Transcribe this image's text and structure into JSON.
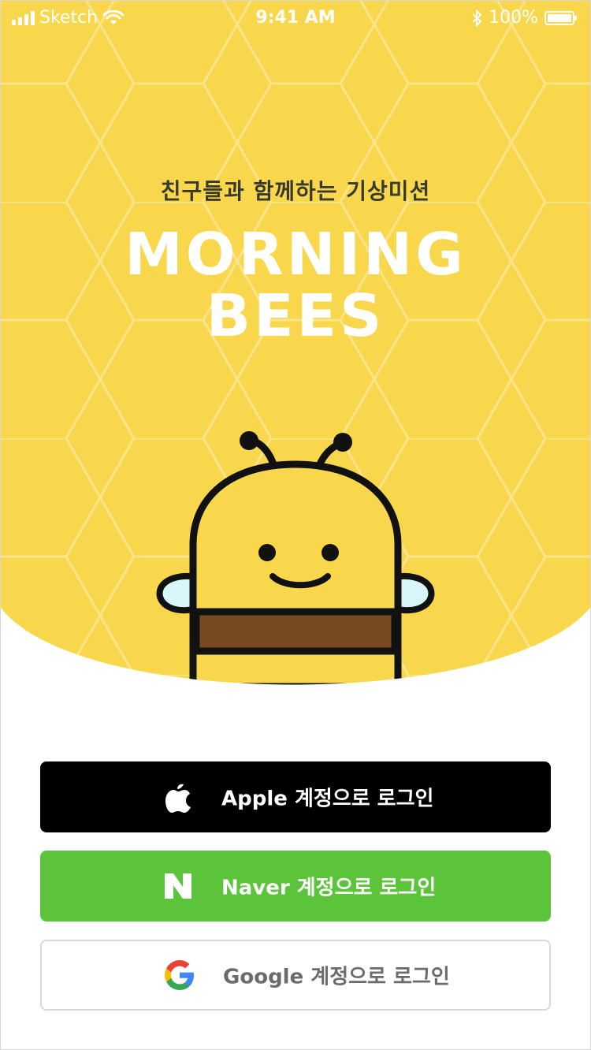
{
  "status_bar": {
    "carrier": "Sketch",
    "time": "9:41 AM",
    "battery": "100%"
  },
  "hero": {
    "tagline": "친구들과 함께하는 기상미션",
    "logo_line1": "MORNING",
    "logo_line2": "BEES"
  },
  "login": {
    "apple_label": "Apple 계정으로 로그인",
    "naver_label": "Naver 계정으로 로그인",
    "google_label": "Google 계정으로 로그인"
  },
  "colors": {
    "hero_yellow": "#f9d74d",
    "honeycomb_line": "#fbe48a",
    "apple_bg": "#000000",
    "naver_bg": "#5cc43b",
    "google_border": "#d9d9d9",
    "bee_brown": "#774a22",
    "wing_blue": "#d8f6fa"
  },
  "icons": {
    "apple": "apple-logo-icon",
    "naver": "naver-n-icon",
    "google": "google-g-icon"
  }
}
